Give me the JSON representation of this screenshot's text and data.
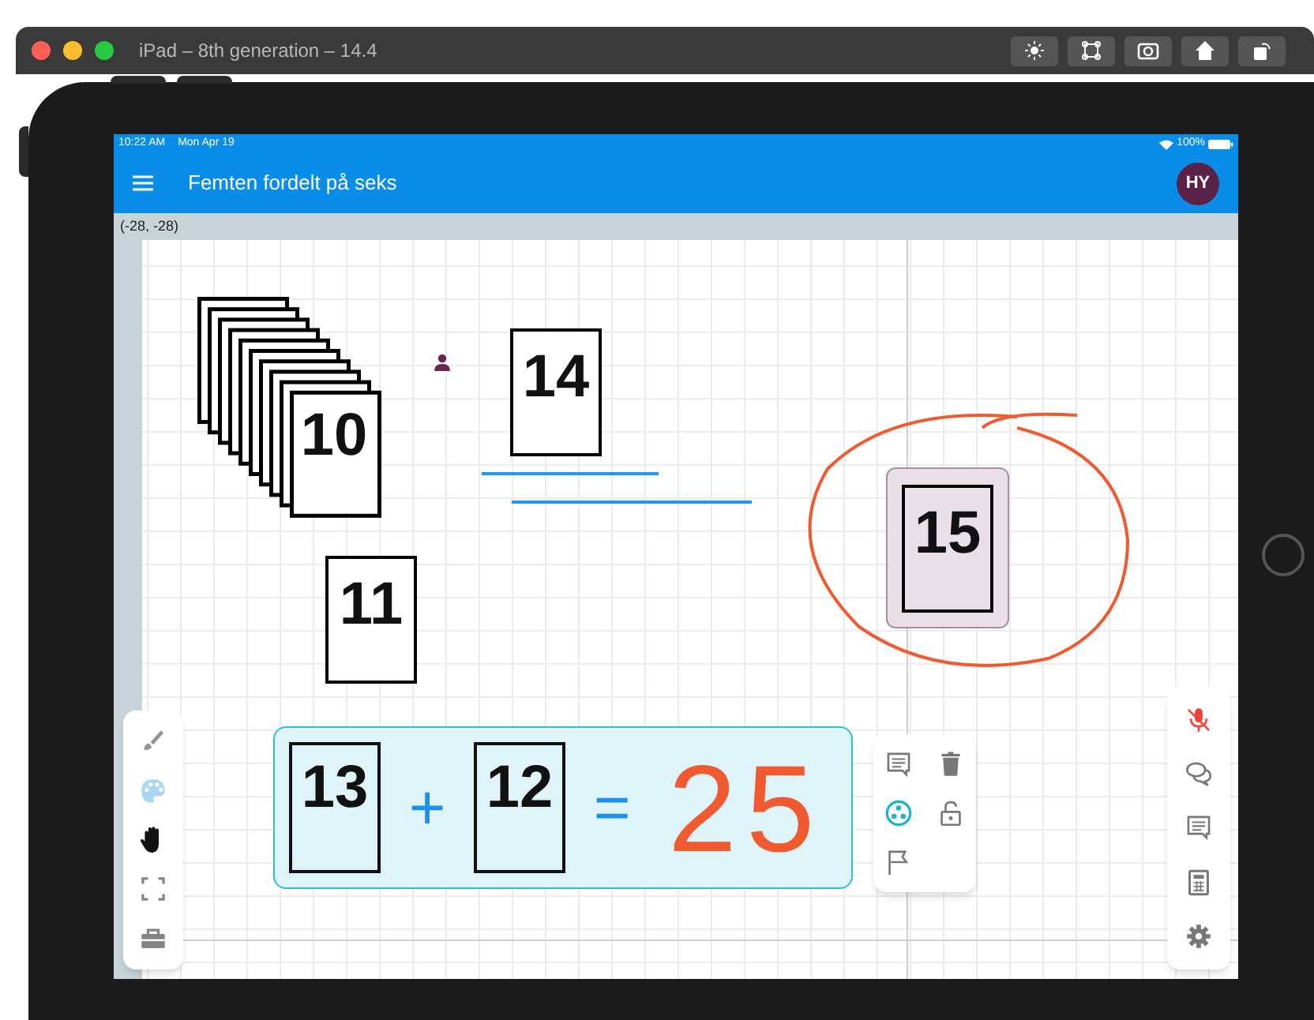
{
  "window": {
    "title": "iPad – 8th generation – 14.4",
    "toolbar": [
      {
        "kind": "brightness"
      },
      {
        "kind": "command"
      },
      {
        "kind": "screenshot"
      },
      {
        "kind": "home"
      },
      {
        "kind": "rotate"
      }
    ]
  },
  "status_bar": {
    "time": "10:22 AM",
    "date": "Mon Apr 19",
    "battery": "100%"
  },
  "app_bar": {
    "title": "Femten fordelt på seks",
    "avatar": "HY"
  },
  "coordinates": "(-28, -28)",
  "cards": [
    {
      "label": "10",
      "kind": "stack",
      "selected": false
    },
    {
      "label": "11",
      "kind": "card",
      "selected": false
    },
    {
      "label": "14",
      "kind": "card",
      "selected": false
    },
    {
      "label": "15",
      "kind": "card",
      "selected": true
    }
  ],
  "group": {
    "items": [
      {
        "kind": "card",
        "text": "13"
      },
      {
        "kind": "ink",
        "text": "+"
      },
      {
        "kind": "card",
        "text": "12"
      },
      {
        "kind": "ink",
        "text": "="
      },
      {
        "kind": "answer",
        "text": "25"
      }
    ]
  },
  "left_tools": [
    {
      "kind": "brush",
      "selected": false
    },
    {
      "kind": "palette",
      "selected": false
    },
    {
      "kind": "hand",
      "selected": true
    },
    {
      "kind": "fit",
      "selected": false
    },
    {
      "kind": "toolbox",
      "selected": false
    }
  ],
  "context_menu": [
    {
      "kind": "comment"
    },
    {
      "kind": "delete"
    },
    {
      "kind": "group"
    },
    {
      "kind": "lock"
    },
    {
      "kind": "flag"
    }
  ],
  "right_tools": [
    {
      "kind": "mic-off"
    },
    {
      "kind": "chat"
    },
    {
      "kind": "comment"
    },
    {
      "kind": "calculator"
    },
    {
      "kind": "settings"
    }
  ]
}
